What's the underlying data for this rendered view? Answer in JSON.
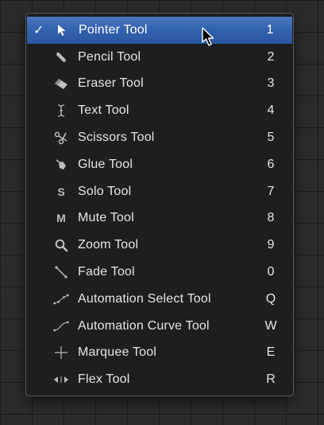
{
  "menu": {
    "items": [
      {
        "label": "Pointer Tool",
        "shortcut": "1",
        "icon": "pointer-arrow-icon",
        "checked": true,
        "check_mark": "✓",
        "selected": true
      },
      {
        "label": "Pencil Tool",
        "shortcut": "2",
        "icon": "pencil-icon"
      },
      {
        "label": "Eraser Tool",
        "shortcut": "3",
        "icon": "eraser-icon"
      },
      {
        "label": "Text Tool",
        "shortcut": "4",
        "icon": "text-cursor-icon"
      },
      {
        "label": "Scissors Tool",
        "shortcut": "5",
        "icon": "scissors-icon"
      },
      {
        "label": "Glue Tool",
        "shortcut": "6",
        "icon": "glue-icon"
      },
      {
        "label": "Solo Tool",
        "shortcut": "7",
        "icon": "solo-icon",
        "glyph": "S"
      },
      {
        "label": "Mute Tool",
        "shortcut": "8",
        "icon": "mute-icon",
        "glyph": "M"
      },
      {
        "label": "Zoom Tool",
        "shortcut": "9",
        "icon": "magnifier-icon"
      },
      {
        "label": "Fade Tool",
        "shortcut": "0",
        "icon": "fade-icon"
      },
      {
        "label": "Automation Select Tool",
        "shortcut": "Q",
        "icon": "automation-select-icon"
      },
      {
        "label": "Automation Curve Tool",
        "shortcut": "W",
        "icon": "automation-curve-icon"
      },
      {
        "label": "Marquee Tool",
        "shortcut": "E",
        "icon": "marquee-crosshair-icon"
      },
      {
        "label": "Flex Tool",
        "shortcut": "R",
        "icon": "flex-arrows-icon"
      }
    ]
  }
}
